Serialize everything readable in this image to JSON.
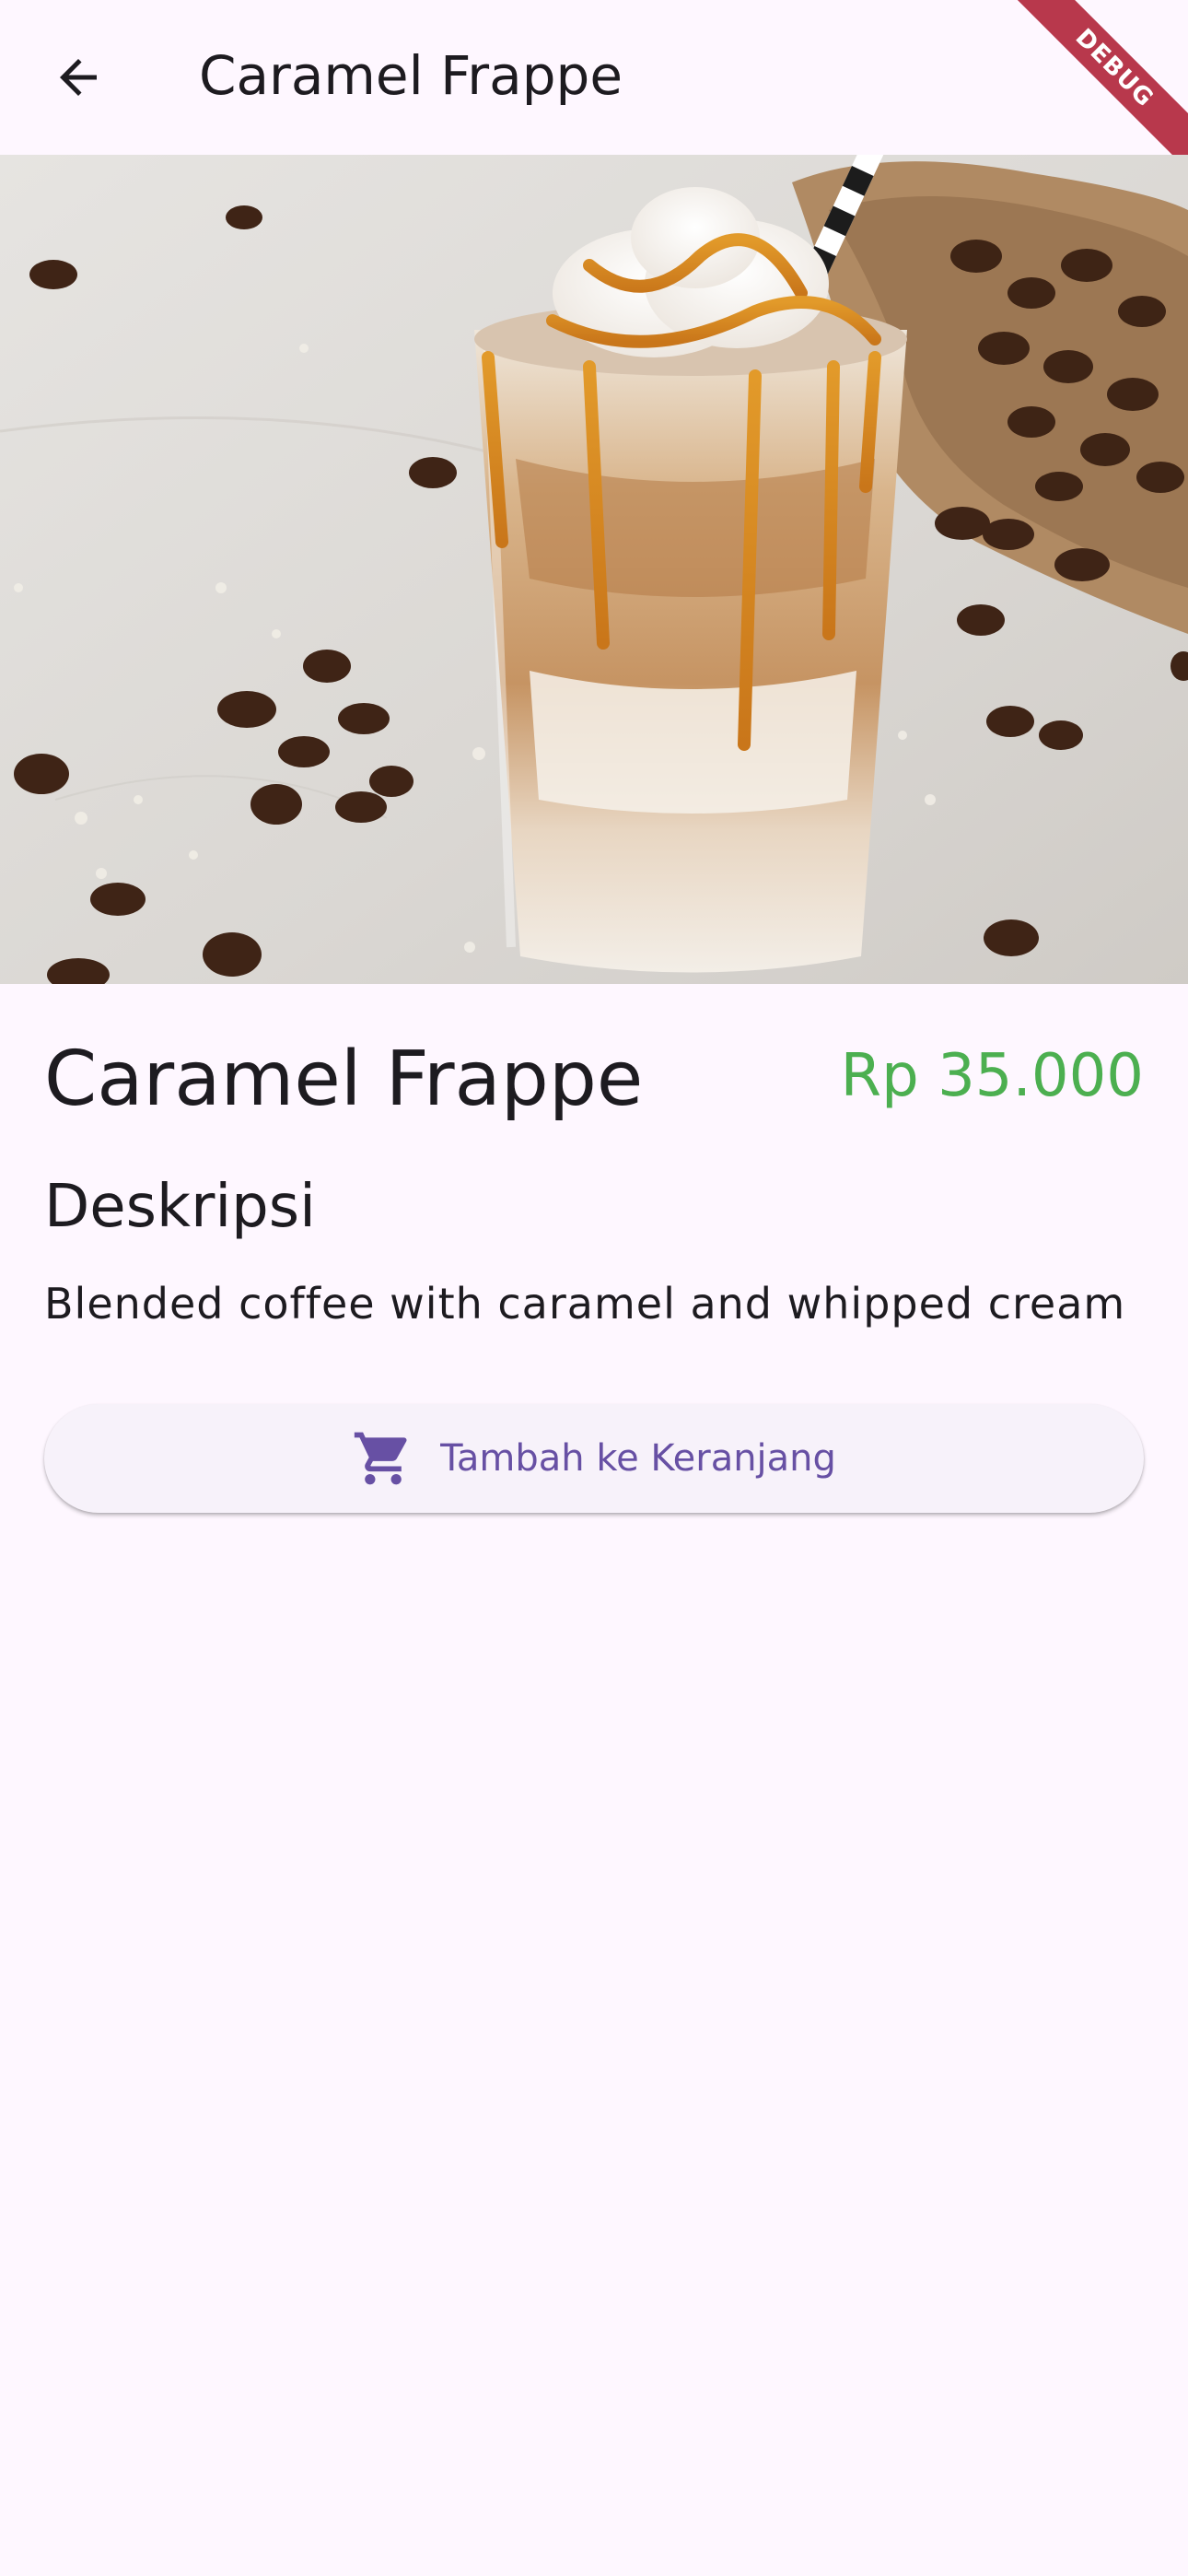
{
  "app_bar": {
    "title": "Caramel Frappe",
    "back_icon": "arrow-back-icon"
  },
  "debug_banner": "DEBUG",
  "product": {
    "name": "Caramel Frappe",
    "price": "Rp 35.000",
    "description_heading": "Deskripsi",
    "description": "Blended coffee with caramel and whipped cream",
    "image_subject": "caramel-frappe-photo"
  },
  "actions": {
    "add_to_cart_label": "Tambah ke Keranjang",
    "add_to_cart_icon": "shopping-cart-icon"
  },
  "colors": {
    "background": "#FEF7FF",
    "price": "#4CAF50",
    "accent": "#6750A4",
    "button_surface": "#F7F2FA",
    "debug_ribbon": "#B8384C"
  }
}
